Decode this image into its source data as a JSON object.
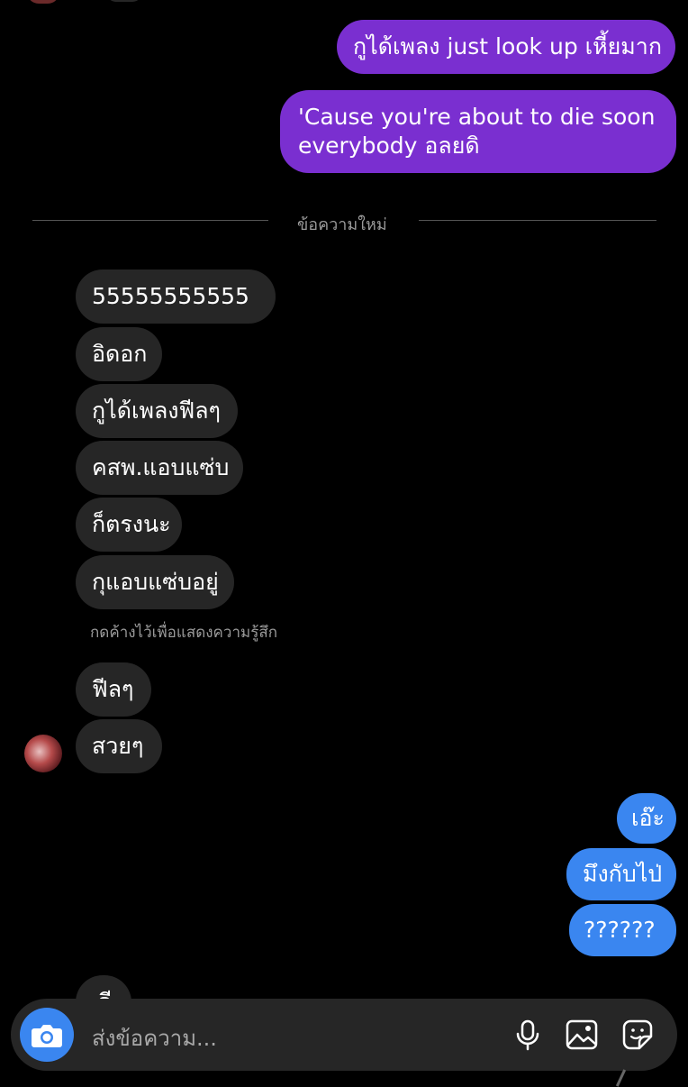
{
  "conversation": {
    "sent_top": [
      {
        "text": "กูได้เพลง just look up เหี้ยมาก"
      },
      {
        "lines": [
          "'Cause you're about to die soon",
          "everybody  อลยดิ"
        ]
      }
    ],
    "divider_label": "ข้อความใหม่",
    "received_group_1": [
      "55555555555",
      "อิดอก",
      "กูได้เพลงฟีลๆ",
      "คสพ.แอบแซ่บ",
      "ก็ตรงนะ",
      "กุแอบแซ่บอยู่"
    ],
    "reaction_hint": "กดค้างไว้เพื่อแสดงความรู้สึก",
    "received_group_2": [
      "ฟีลๆ",
      "สวยๆ"
    ],
    "sent_bottom": [
      "เอ๊ะ",
      "มึงกับไป่",
      "??????"
    ],
    "partial_received": "ดี"
  },
  "composer": {
    "placeholder": "ส่งข้อความ...",
    "icons": [
      "camera-icon",
      "microphone-icon",
      "gallery-icon",
      "sticker-icon"
    ]
  },
  "colors": {
    "background": "#000000",
    "sent_purple": "#7a2fd0",
    "sent_blue": "#3a86f0",
    "received_gray": "#262626",
    "muted_text": "#9a9a9a"
  }
}
